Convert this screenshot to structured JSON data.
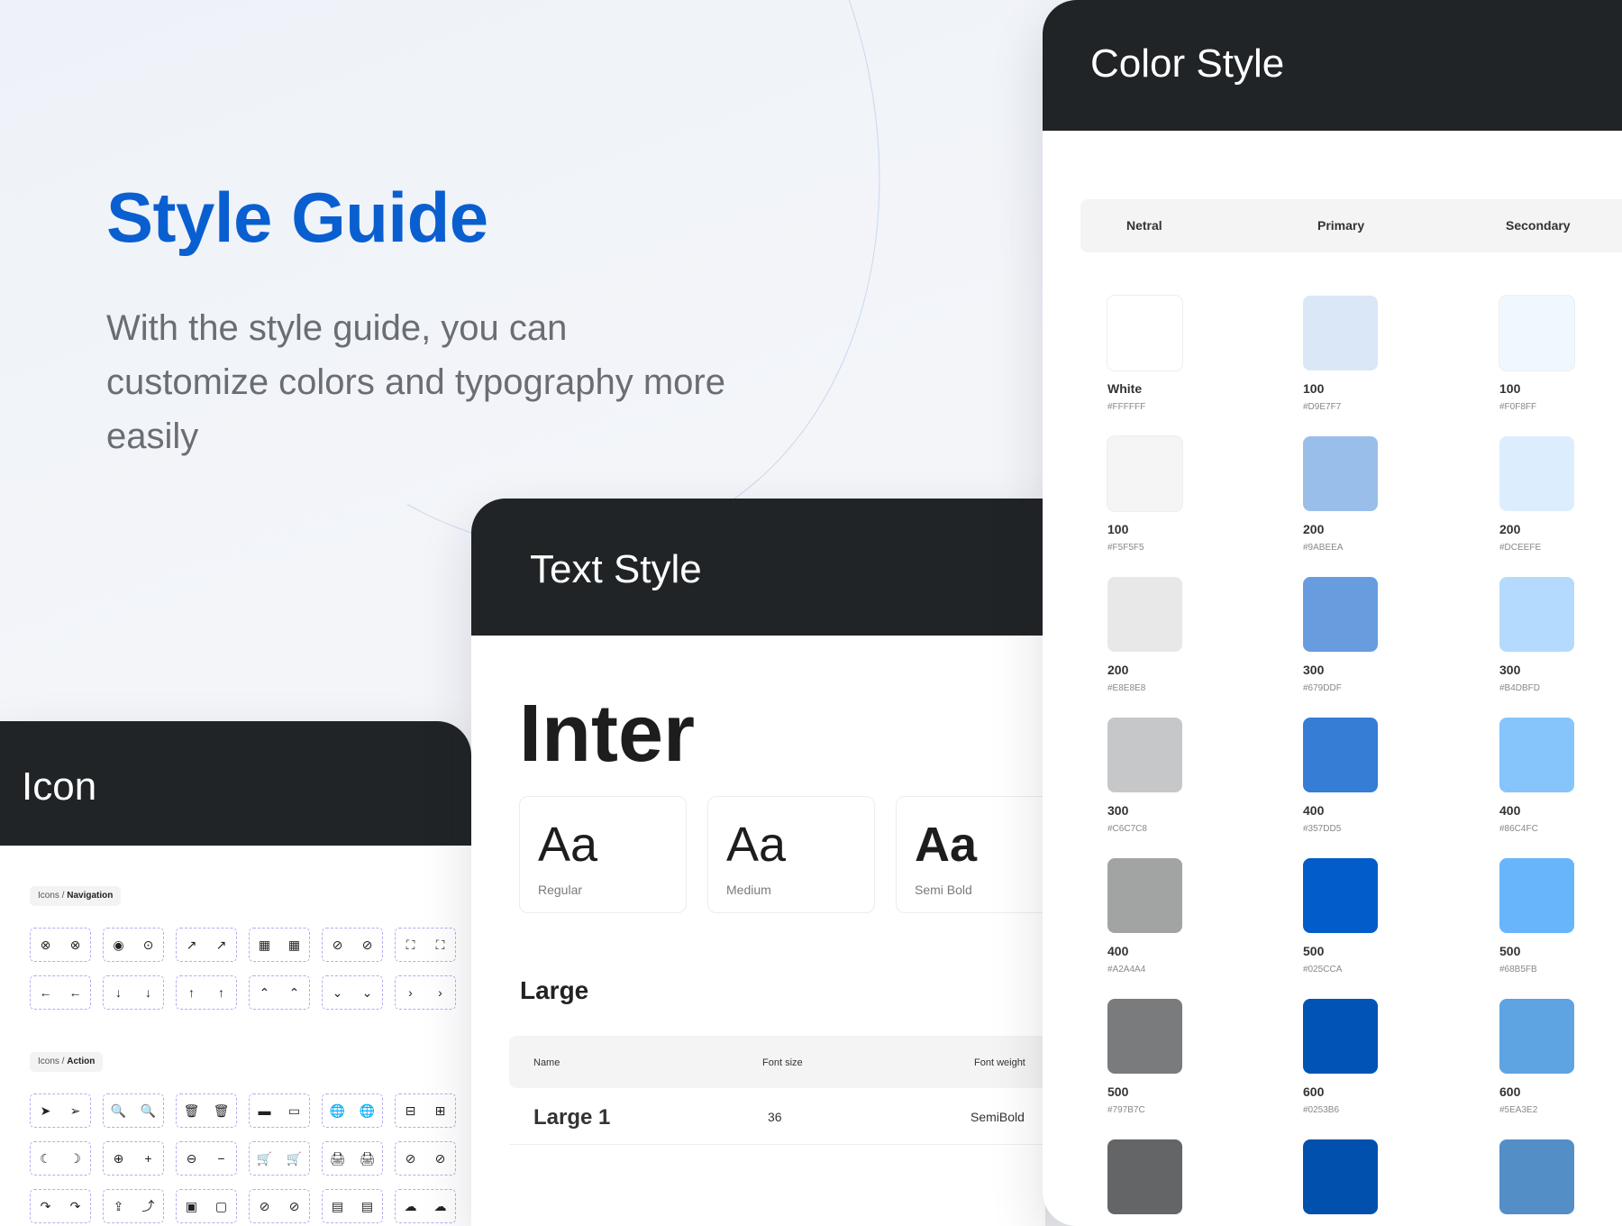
{
  "hero": {
    "title": "Style Guide",
    "description": "With the style guide, you can customize colors and typography more easily"
  },
  "icon_card": {
    "title": "Icon",
    "navigation_crumb": {
      "prefix": "Icons / ",
      "label": "Navigation"
    },
    "action_crumb": {
      "prefix": "Icons / ",
      "label": "Action"
    },
    "navigation_rows": [
      [
        "⊗",
        "⊗",
        "◉",
        "⊙",
        "↗",
        "↗",
        "▦",
        "▦",
        "⊘",
        "⊘",
        "⛶",
        "⛶"
      ],
      [
        "←",
        "←",
        "↓",
        "↓",
        "↑",
        "↑",
        "⌃",
        "⌃",
        "⌄",
        "⌄",
        "›",
        "›"
      ]
    ],
    "action_rows": [
      [
        "➤",
        "➢",
        "🔍",
        "🔍",
        "🗑",
        "🗑",
        "▬",
        "▭",
        "🌐",
        "🌐",
        "⊟",
        "⊞"
      ],
      [
        "☾",
        "☽",
        "⊕",
        "+",
        "⊖",
        "−",
        "🛒",
        "🛒",
        "🖨",
        "🖨",
        "⊘",
        "⊘"
      ],
      [
        "↷",
        "↷",
        "⇪",
        "⤴",
        "▣",
        "▢",
        "⊘",
        "⊘",
        "▤",
        "▤",
        "☁",
        "☁"
      ]
    ]
  },
  "text_card": {
    "title": "Text Style",
    "font_name": "Inter",
    "samples": [
      {
        "glyph": "Aa",
        "weight": "Regular"
      },
      {
        "glyph": "Aa",
        "weight": "Medium"
      },
      {
        "glyph": "Aa",
        "weight": "Semi Bold"
      }
    ],
    "size_title": "Large",
    "table": {
      "headers": {
        "name": "Name",
        "size": "Font size",
        "weight": "Font weight"
      },
      "rows": [
        {
          "name": "Large 1",
          "size": "36",
          "weight": "SemiBold"
        }
      ]
    }
  },
  "color_card": {
    "title": "Color Style",
    "tabs": [
      "Netral",
      "Primary",
      "Secondary"
    ],
    "neutral": [
      {
        "name": "White",
        "hex": "#FFFFFF"
      },
      {
        "name": "100",
        "hex": "#F5F5F5"
      },
      {
        "name": "200",
        "hex": "#E8E8E8"
      },
      {
        "name": "300",
        "hex": "#C6C7C8"
      },
      {
        "name": "400",
        "hex": "#A2A4A4"
      },
      {
        "name": "500",
        "hex": "#797B7C"
      },
      {
        "name": "",
        "hex": "",
        "color": "#636566"
      }
    ],
    "primary": [
      {
        "name": "100",
        "hex": "#D9E7F7"
      },
      {
        "name": "200",
        "hex": "#9ABEEA"
      },
      {
        "name": "300",
        "hex": "#679DDF"
      },
      {
        "name": "400",
        "hex": "#357DD5"
      },
      {
        "name": "500",
        "hex": "#025CCA"
      },
      {
        "name": "600",
        "hex": "#0253B6"
      },
      {
        "name": "",
        "hex": "",
        "color": "#0250AE"
      }
    ],
    "secondary": [
      {
        "name": "100",
        "hex": "#F0F8FF"
      },
      {
        "name": "200",
        "hex": "#DCEEFE"
      },
      {
        "name": "300",
        "hex": "#B4DBFD"
      },
      {
        "name": "400",
        "hex": "#86C4FC"
      },
      {
        "name": "500",
        "hex": "#68B5FB"
      },
      {
        "name": "600",
        "hex": "#5EA3E2"
      },
      {
        "name": "",
        "hex": "",
        "color": "#538FC6"
      }
    ]
  }
}
